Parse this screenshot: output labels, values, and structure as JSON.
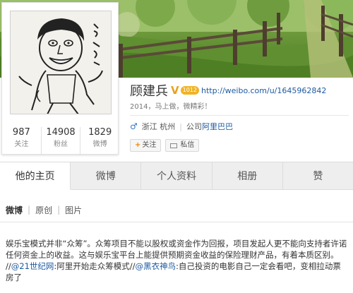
{
  "profile": {
    "name": "顾建兵",
    "verified_badge": "V",
    "rank_badge": "1012",
    "url": "http://weibo.com/u/1645962842",
    "bio": "2014，马上做，微精彩！",
    "location": "浙江 杭州",
    "company_prefix": "公司",
    "company_name": "阿里巴巴",
    "follow_label": "关注",
    "message_label": "私信"
  },
  "stats": [
    {
      "value": "987",
      "label": "关注"
    },
    {
      "value": "14908",
      "label": "粉丝"
    },
    {
      "value": "1829",
      "label": "微博"
    }
  ],
  "tabs": [
    "他的主页",
    "微博",
    "个人资料",
    "相册",
    "赞"
  ],
  "subnav": [
    "微博",
    "原创",
    "图片"
  ],
  "post": {
    "text": "娱乐宝模式并非“众筹”。众筹项目不能以股权或资金作为回报，项目发起人更不能向支持者许诺任何资金上的收益。这与娱乐宝平台上能提供预期资金收益的保险理财产品，有着本质区别。 //",
    "mention1": "@21世纪网",
    "text2": ":阿里开始走众筹模式//",
    "mention2": "@黑衣神鸟",
    "text3": ":自己投资的电影自己一定会看吧，变相拉动票房了"
  },
  "colors": {
    "link": "#1d5aa1",
    "badge_orange": "#e8a21c",
    "follow_plus": "#f08300"
  }
}
